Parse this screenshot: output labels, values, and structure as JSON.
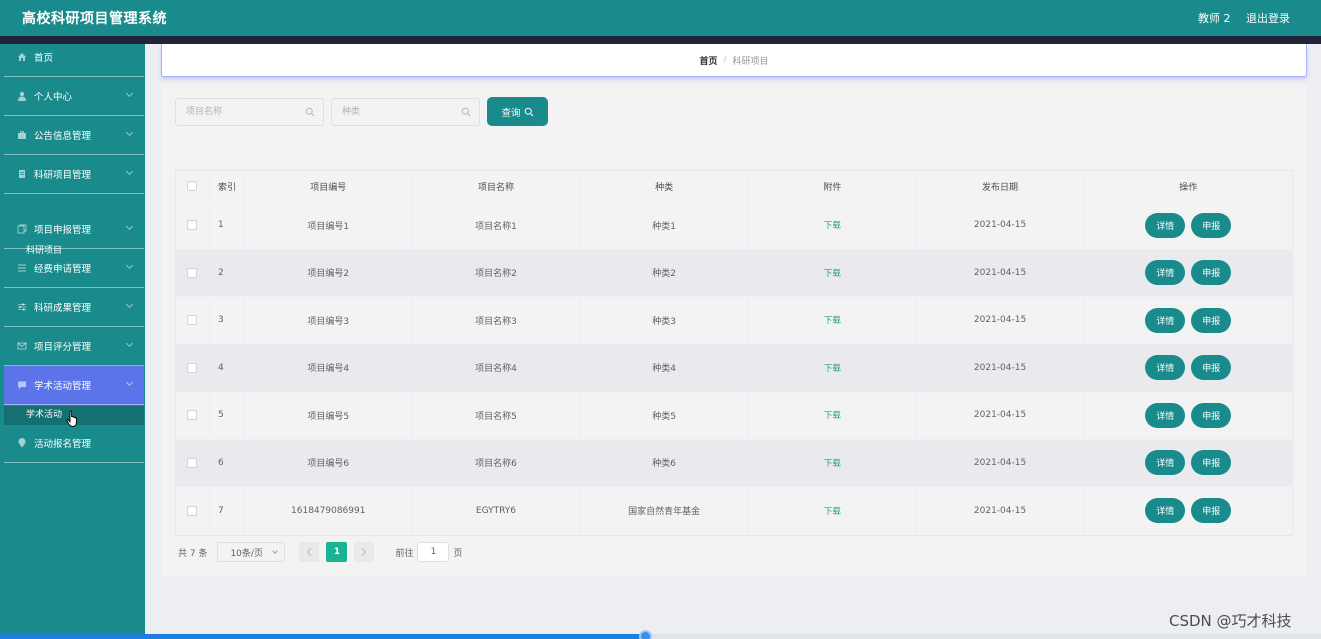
{
  "header": {
    "title": "高校科研项目管理系统",
    "user": "教师 2",
    "logout": "退出登录"
  },
  "sidebar": {
    "items": [
      {
        "label": "首页",
        "icon": "home-icon"
      },
      {
        "label": "个人中心",
        "icon": "user-icon"
      },
      {
        "label": "公告信息管理",
        "icon": "briefcase-icon"
      },
      {
        "label": "科研项目管理",
        "icon": "document-icon"
      },
      {
        "label": "项目申报管理",
        "icon": "copy-icon"
      },
      {
        "label": "经费申请管理",
        "icon": "list-icon"
      },
      {
        "label": "科研成果管理",
        "icon": "sliders-icon"
      },
      {
        "label": "项目评分管理",
        "icon": "mail-icon"
      },
      {
        "label": "学术活动管理",
        "icon": "chat-icon"
      },
      {
        "label": "活动报名管理",
        "icon": "location-icon"
      }
    ],
    "sub_research": "科研项目",
    "sub_academic": "学术活动"
  },
  "breadcrumb": {
    "home": "首页",
    "separator": "/",
    "current": "科研项目"
  },
  "search": {
    "name_placeholder": "项目名称",
    "type_placeholder": "种类",
    "button": "查询"
  },
  "table": {
    "headers": [
      "索引",
      "项目编号",
      "项目名称",
      "种类",
      "附件",
      "发布日期",
      "操作"
    ],
    "rows": [
      {
        "index": "1",
        "code": "项目编号1",
        "name": "项目名称1",
        "type": "种类1",
        "file": "下载",
        "date": "2021-04-15"
      },
      {
        "index": "2",
        "code": "项目编号2",
        "name": "项目名称2",
        "type": "种类2",
        "file": "下载",
        "date": "2021-04-15"
      },
      {
        "index": "3",
        "code": "项目编号3",
        "name": "项目名称3",
        "type": "种类3",
        "file": "下载",
        "date": "2021-04-15"
      },
      {
        "index": "4",
        "code": "项目编号4",
        "name": "项目名称4",
        "type": "种类4",
        "file": "下载",
        "date": "2021-04-15"
      },
      {
        "index": "5",
        "code": "项目编号5",
        "name": "项目名称5",
        "type": "种类5",
        "file": "下载",
        "date": "2021-04-15"
      },
      {
        "index": "6",
        "code": "项目编号6",
        "name": "项目名称6",
        "type": "种类6",
        "file": "下载",
        "date": "2021-04-15"
      },
      {
        "index": "7",
        "code": "1618479086991",
        "name": "EGYTRY6",
        "type": "国家自然青年基金",
        "file": "下载",
        "date": "2021-04-15"
      }
    ],
    "detail_label": "详情",
    "apply_label": "申报"
  },
  "pagination": {
    "total": "共 7 条",
    "page_size": "10条/页",
    "current_page": "1",
    "goto_label": "前往",
    "goto_value": "1",
    "page_suffix": "页"
  },
  "watermark": "CSDN @巧才科技",
  "colors": {
    "primary": "#1a8b8c",
    "active_menu": "#5b74ea",
    "current_page": "#19b394",
    "download_link": "#1fa08a"
  }
}
